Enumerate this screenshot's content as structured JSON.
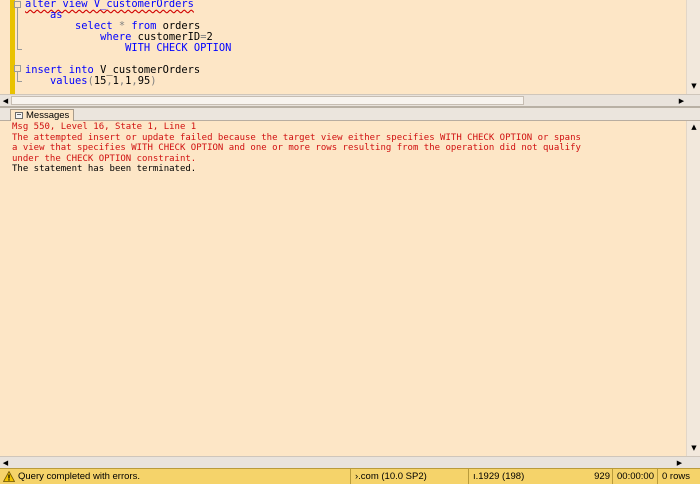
{
  "editor": {
    "lines": [
      {
        "parts": [
          {
            "text": "alter view V_customerOrders",
            "cls": "kw squiggle"
          }
        ]
      },
      {
        "parts": [
          {
            "text": "    ",
            "cls": ""
          },
          {
            "text": "as",
            "cls": "kw"
          }
        ]
      },
      {
        "parts": [
          {
            "text": "        ",
            "cls": ""
          },
          {
            "text": "select",
            "cls": "kw"
          },
          {
            "text": " * ",
            "cls": "op"
          },
          {
            "text": "from",
            "cls": "kw"
          },
          {
            "text": " orders",
            "cls": ""
          }
        ]
      },
      {
        "parts": [
          {
            "text": "            ",
            "cls": ""
          },
          {
            "text": "where",
            "cls": "kw"
          },
          {
            "text": " customerID",
            "cls": ""
          },
          {
            "text": "=",
            "cls": "op"
          },
          {
            "text": "2",
            "cls": ""
          }
        ]
      },
      {
        "parts": [
          {
            "text": "                ",
            "cls": ""
          },
          {
            "text": "WITH CHECK OPTION",
            "cls": "kw"
          }
        ]
      },
      {
        "parts": []
      },
      {
        "parts": [
          {
            "text": "insert into",
            "cls": "kw"
          },
          {
            "text": " V_customerOrders",
            "cls": ""
          }
        ]
      },
      {
        "parts": [
          {
            "text": "    ",
            "cls": ""
          },
          {
            "text": "values",
            "cls": "kw"
          },
          {
            "text": "(",
            "cls": "op"
          },
          {
            "text": "15",
            "cls": ""
          },
          {
            "text": ",",
            "cls": "op"
          },
          {
            "text": "1",
            "cls": ""
          },
          {
            "text": ",",
            "cls": "op"
          },
          {
            "text": "1",
            "cls": ""
          },
          {
            "text": ",",
            "cls": "op"
          },
          {
            "text": "95",
            "cls": ""
          },
          {
            "text": ")",
            "cls": "op"
          }
        ]
      }
    ]
  },
  "results_tab": {
    "label": "Messages",
    "icon": "messages-icon"
  },
  "messages": {
    "lines": [
      {
        "text": "Msg 550, Level 16, State 1, Line 1",
        "color": "red"
      },
      {
        "text": "The attempted insert or update failed because the target view either specifies WITH CHECK OPTION or spans",
        "color": "red"
      },
      {
        "text": "a view that specifies WITH CHECK OPTION and one or more rows resulting from the operation did not qualify",
        "color": "red"
      },
      {
        "text": "under the CHECK OPTION constraint.",
        "color": "red"
      },
      {
        "text": "The statement has been terminated.",
        "color": "black"
      }
    ]
  },
  "statusbar": {
    "status_icon": "warning-icon",
    "status_text": "Query completed with errors.",
    "server": "›.com (10.0 SP2)",
    "user": "ı.1929 (198)",
    "spid": "929",
    "elapsed": "00:00:00",
    "rows": "0 rows"
  },
  "colors": {
    "editor_bg": "#fde6c6",
    "keyword": "#0000ff",
    "error_text": "#d01010",
    "statusbar_bg": "#f5d36a",
    "change_bar": "#e9c200"
  }
}
